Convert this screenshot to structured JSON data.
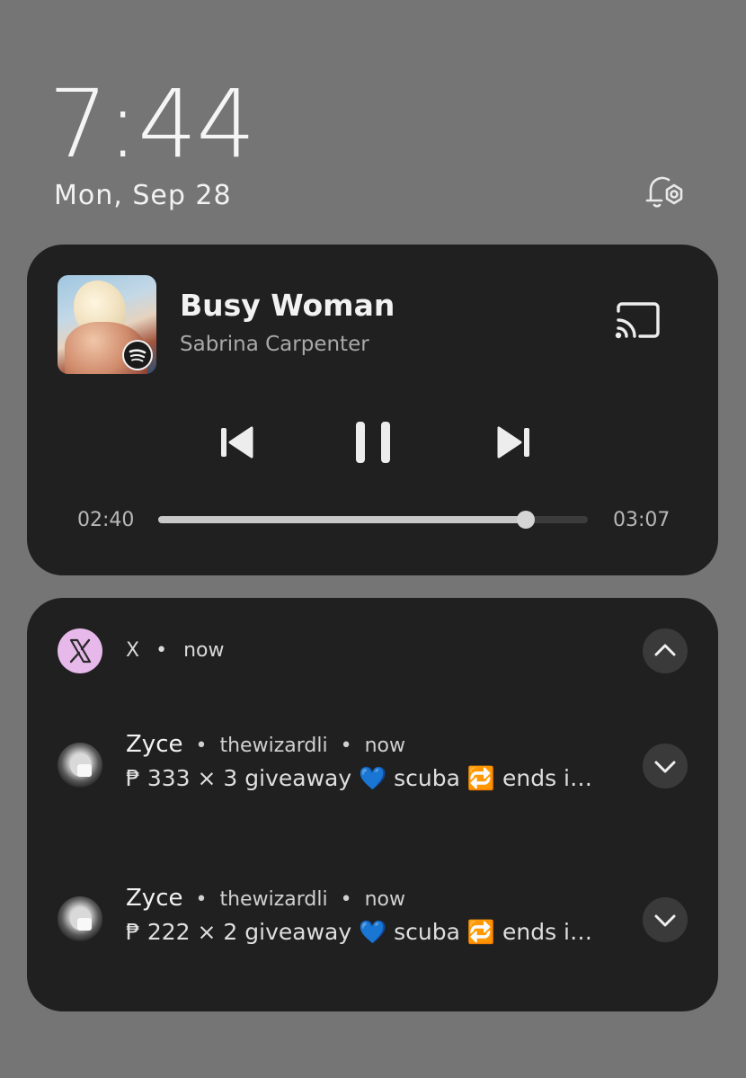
{
  "lockscreen": {
    "time": "7:44",
    "date": "Mon, Sep 28"
  },
  "media": {
    "title": "Busy Woman",
    "artist": "Sabrina Carpenter",
    "elapsed": "02:40",
    "duration": "03:07",
    "progress_fraction": 0.855,
    "source_icon": "spotify-icon"
  },
  "notification_group": {
    "app": "X",
    "time": "now",
    "items": [
      {
        "name": "Zyce",
        "handle": "thewizardli",
        "time": "now",
        "body": "₱ 333 × 3 giveaway 💙  scuba 🔁  ends i…"
      },
      {
        "name": "Zyce",
        "handle": "thewizardli",
        "time": "now",
        "body": "₱ 222 × 2 giveaway 💙  scuba 🔁  ends i…"
      }
    ]
  },
  "colors": {
    "background": "#757575",
    "card": "#202020",
    "x_icon_bg": "#e7b8ea"
  }
}
